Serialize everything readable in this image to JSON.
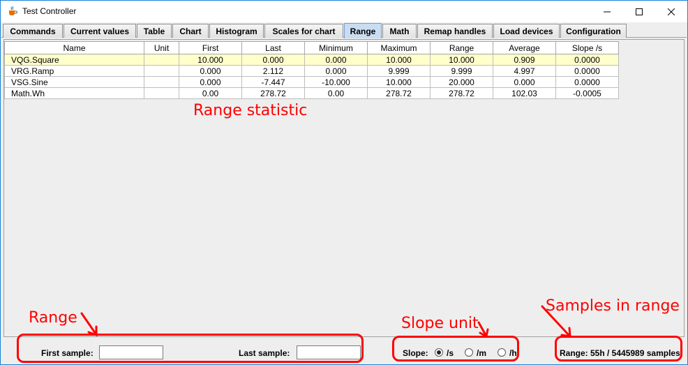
{
  "window": {
    "title": "Test Controller"
  },
  "tabs": [
    {
      "label": "Commands",
      "name": "tab-commands"
    },
    {
      "label": "Current values",
      "name": "tab-current-values"
    },
    {
      "label": "Table",
      "name": "tab-table"
    },
    {
      "label": "Chart",
      "name": "tab-chart"
    },
    {
      "label": "Histogram",
      "name": "tab-histogram"
    },
    {
      "label": "Scales for chart",
      "name": "tab-scales-for-chart"
    },
    {
      "label": "Range",
      "name": "tab-range"
    },
    {
      "label": "Math",
      "name": "tab-math"
    },
    {
      "label": "Remap handles",
      "name": "tab-remap-handles"
    },
    {
      "label": "Load devices",
      "name": "tab-load-devices"
    },
    {
      "label": "Configuration",
      "name": "tab-configuration"
    }
  ],
  "active_tab": "Range",
  "table": {
    "headers": [
      "Name",
      "Unit",
      "First",
      "Last",
      "Minimum",
      "Maximum",
      "Range",
      "Average",
      "Slope /s"
    ],
    "rows": [
      [
        "VQG.Square",
        "",
        "10.000",
        "0.000",
        "0.000",
        "10.000",
        "10.000",
        "0.909",
        "0.0000"
      ],
      [
        "VRG.Ramp",
        "",
        "0.000",
        "2.112",
        "0.000",
        "9.999",
        "9.999",
        "4.997",
        "0.0000"
      ],
      [
        "VSG.Sine",
        "",
        "0.000",
        "-7.447",
        "-10.000",
        "10.000",
        "20.000",
        "0.000",
        "0.0000"
      ],
      [
        "Math.Wh",
        "",
        "0.00",
        "278.72",
        "0.00",
        "278.72",
        "278.72",
        "102.03",
        "-0.0005"
      ]
    ]
  },
  "bottom": {
    "first_sample_label": "First sample:",
    "first_sample_value": "",
    "last_sample_label": "Last sample:",
    "last_sample_value": "",
    "slope_label": "Slope:",
    "slope_options": [
      "/s",
      "/m",
      "/h"
    ],
    "slope_selected": "/s",
    "range_status": "Range: 55h / 5445989 samples"
  },
  "annotations": {
    "range_statistic": "Range statistic",
    "range": "Range",
    "slope_unit": "Slope unit",
    "samples_in_range": "Samples in range"
  },
  "colors": {
    "annotation": "#ff0000",
    "selected_row": "#ffffcc",
    "active_tab": "#c9ddf2",
    "window_border": "#1883d7"
  }
}
